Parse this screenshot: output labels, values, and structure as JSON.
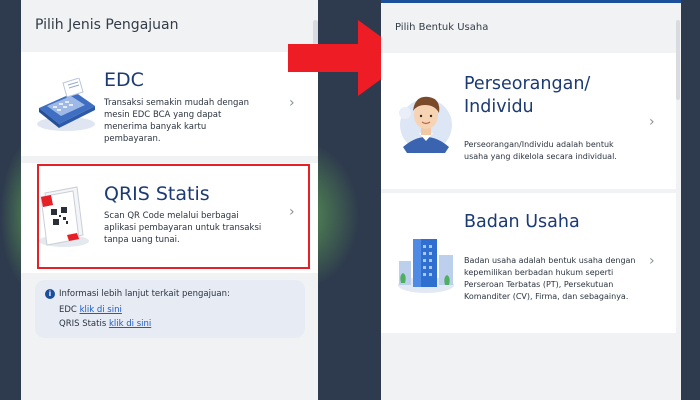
{
  "left": {
    "header": "Pilih Jenis Pengajuan",
    "cards": [
      {
        "title": "EDC",
        "description": "Transaksi semakin mudah dengan mesin EDC BCA yang dapat menerima banyak kartu pembayaran.",
        "icon": "edc-machine-icon"
      },
      {
        "title": "QRIS Statis",
        "description": "Scan QR Code melalui berbagai aplikasi pembayaran untuk transaksi tanpa uang tunai.",
        "icon": "qris-standee-icon"
      }
    ],
    "info": {
      "title": "Informasi lebih lanjut terkait pengajuan:",
      "rows": [
        {
          "label": "EDC",
          "link": "klik di sini"
        },
        {
          "label": "QRIS Statis",
          "link": "klik di sini"
        }
      ]
    }
  },
  "right": {
    "header": "Pilih Bentuk Usaha",
    "cards": [
      {
        "title": "Perseorangan/ Individu",
        "description": "Perseorangan/Individu adalah bentuk usaha yang dikelola secara individual.",
        "icon": "person-avatar-icon"
      },
      {
        "title": "Badan Usaha",
        "description": "Badan usaha adalah bentuk usaha dengan kepemilikan berbadan hukum seperti Perseroan Terbatas (PT), Persekutuan Komanditer (CV), Firma, dan sebagainya.",
        "icon": "office-building-icon"
      }
    ]
  },
  "colors": {
    "highlight": "#e52027",
    "arrow": "#ee1c25",
    "brand": "#1b4f9c",
    "background": "#2e3a4d"
  }
}
